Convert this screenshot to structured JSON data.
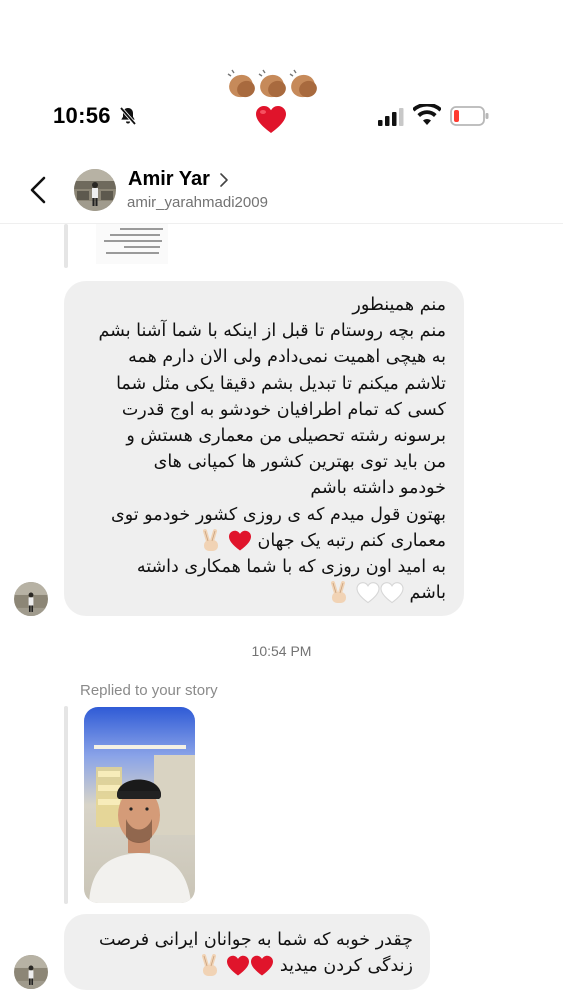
{
  "status_bar": {
    "time": "10:56"
  },
  "header": {
    "name": "Amir Yar",
    "handle": "amir_yarahmadi2009"
  },
  "messages": {
    "first": {
      "lines": [
        "منم همینطور",
        "منم بچه روستام تا قبل از اینکه با شما آشنا بشم",
        "به هیچی اهمیت نمی‌دادم ولی الان دارم همه",
        "تلاشم میکنم تا تبدیل بشم دقیقا یکی مثل شما",
        "کسی که تمام اطرافیان خودشو به اوج قدرت",
        "برسونه  رشته تحصیلی من معماری هستش و",
        "من باید توی بهترین کشور ها کمپانی های",
        "خودمو داشته باشم",
        "بهتون قول میدم که ی روزی کشور خودمو توی",
        "معماری کنم رتبه یک جهان",
        "به امید اون روزی که با شما همکاری داشته",
        "باشم"
      ]
    },
    "timestamp": "10:54 PM",
    "replied_label": "Replied to your story",
    "second": {
      "lines": [
        "چقدر خوبه که شما به جوانان ایرانی فرصت",
        "زندگی کردن میدید"
      ]
    }
  },
  "icons": {
    "back": "chevron-left-icon",
    "silent": "bell-slash-icon",
    "signal": "cellular-signal-icon",
    "wifi": "wifi-icon",
    "battery": "battery-low-icon",
    "reactions": [
      "clapping-hands",
      "red-heart",
      "white-heart",
      "victory-hand"
    ]
  },
  "colors": {
    "bubble": "#efefef",
    "heart": "#e0142b",
    "battery_low": "#ff3b30",
    "secondary_text": "#737373"
  }
}
